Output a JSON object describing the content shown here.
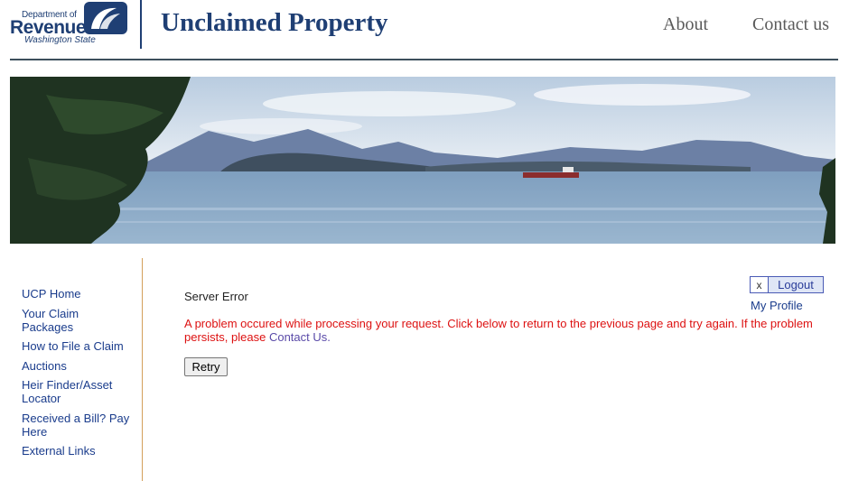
{
  "header": {
    "logo": {
      "line1": "Department of",
      "line2": "Revenue",
      "line3": "Washington State"
    },
    "title": "Unclaimed Property",
    "nav": [
      {
        "label": "About"
      },
      {
        "label": "Contact us"
      }
    ]
  },
  "sidebar": {
    "items": [
      {
        "label": "UCP Home"
      },
      {
        "label": "Your Claim Packages"
      },
      {
        "label": "How to File a Claim"
      },
      {
        "label": "Auctions"
      },
      {
        "label": "Heir Finder/Asset Locator"
      },
      {
        "label": "Received a Bill? Pay Here"
      },
      {
        "label": "External Links"
      }
    ]
  },
  "main": {
    "heading": "Server Error",
    "error_message": "A problem occured while processing your request. Click below to return to the previous page and try again. If the problem persists, please",
    "contact_link": "Contact Us.",
    "retry_label": "Retry"
  },
  "account": {
    "logout_x": "x",
    "logout_label": "Logout",
    "profile_label": "My Profile"
  },
  "colors": {
    "brand_navy": "#1f3f74",
    "link_blue": "#1a3c8c",
    "error_red": "#dd1111",
    "divider_gold": "#d4a05a"
  }
}
